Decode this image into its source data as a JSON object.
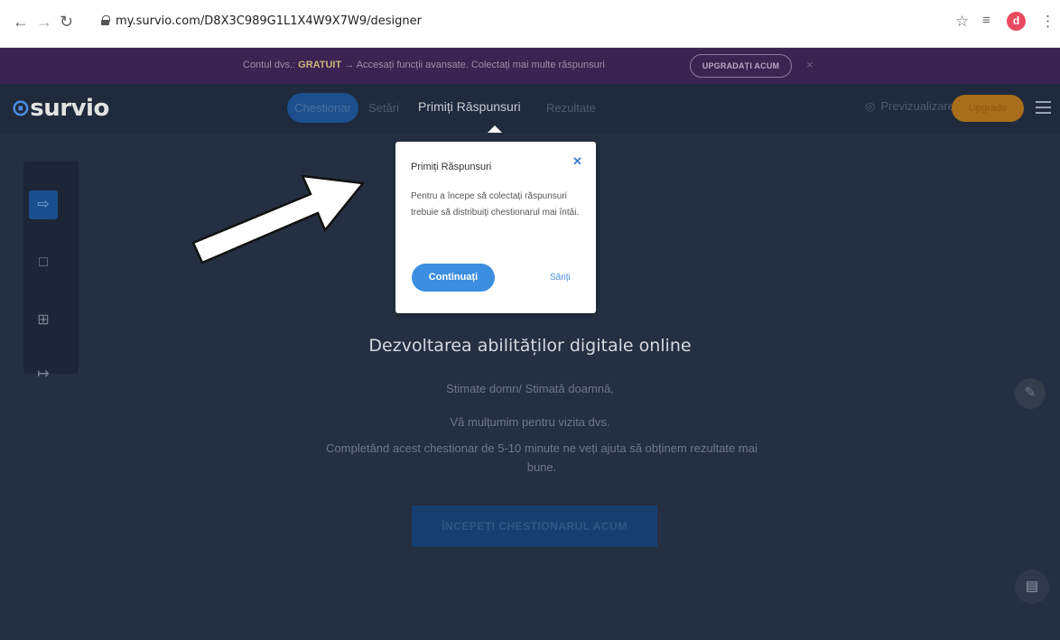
{
  "browser": {
    "url": "my.survio.com/D8X3C989G1L1X4W9X7W9/designer",
    "profile_letter": "d"
  },
  "promo": {
    "text_prefix": "Contul dvs.: ",
    "plan": "GRATUIT",
    "text_suffix": " → Accesați funcții avansate. Colectați mai multe răspunsuri",
    "button": "UPGRADAȚI ACUM",
    "close": "×"
  },
  "header": {
    "logo": "survio",
    "tabs": [
      "Chestionar",
      "Setări",
      "Primiți Răspunsuri",
      "Rezultate"
    ],
    "preview": "Previzualizare",
    "upgrade": "Upgrade"
  },
  "popup": {
    "title": "Primiți Răspunsuri",
    "text": "Pentru a începe să colectați răspunsuri trebuie să distribuiți chestionarul mai întâi.",
    "continue": "Continuați",
    "skip": "Săriți"
  },
  "survey": {
    "title": "Dezvoltarea abilităților digitale online",
    "greeting": "Stimate domn/ Stimată doamnă,",
    "thanks": "Vă mulțumim pentru vizita dvs.",
    "description": "Completând acest chestionar de 5-10 minute ne veți ajuta să obținem rezultate mai bune.",
    "start_button": "ÎNCEPEȚI CHESTIONARUL ACUM"
  },
  "colors": {
    "accent": "#3b8ee0",
    "promo_bg": "#3b2451",
    "header_bg": "#1f2a3c",
    "upgrade": "#a86e1b"
  }
}
